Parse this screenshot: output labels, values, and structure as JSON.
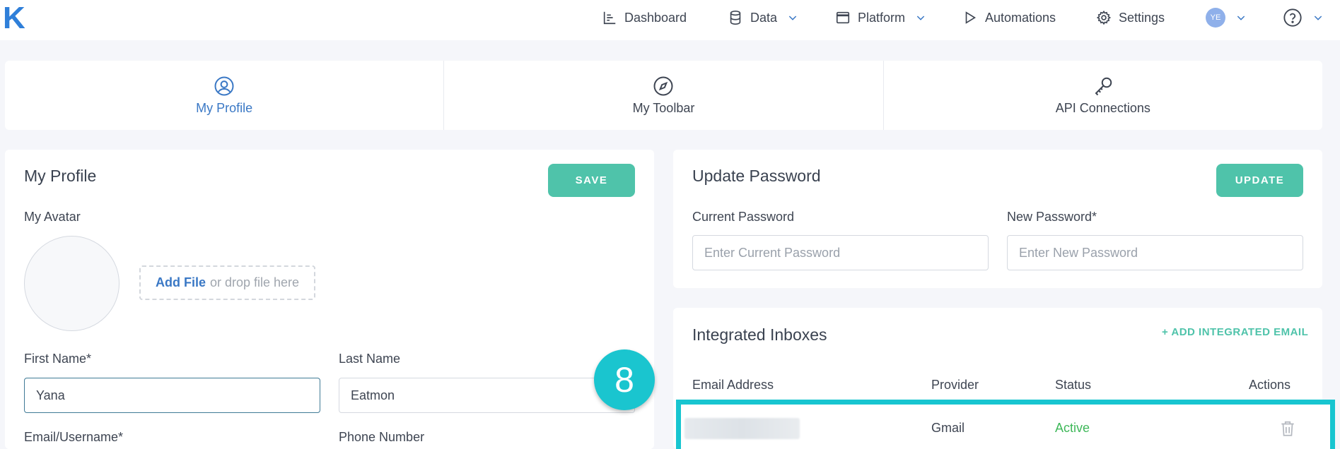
{
  "app": {
    "logo": "K"
  },
  "nav": {
    "dashboard": "Dashboard",
    "data": "Data",
    "platform": "Platform",
    "automations": "Automations",
    "settings": "Settings",
    "user_initials": "YE"
  },
  "tabs": [
    {
      "label": "My Profile",
      "active": true
    },
    {
      "label": "My Toolbar",
      "active": false
    },
    {
      "label": "API Connections",
      "active": false
    }
  ],
  "profile": {
    "title": "My Profile",
    "save_label": "SAVE",
    "avatar_label": "My Avatar",
    "add_file": "Add File",
    "drop_text": "or drop file here",
    "first_name_label": "First Name*",
    "first_name_value": "Yana",
    "last_name_label": "Last Name",
    "last_name_value": "Eatmon",
    "email_label": "Email/Username*",
    "phone_label": "Phone Number"
  },
  "password": {
    "title": "Update Password",
    "update_label": "UPDATE",
    "current_label": "Current Password",
    "current_placeholder": "Enter Current Password",
    "new_label": "New Password*",
    "new_placeholder": "Enter New Password"
  },
  "inboxes": {
    "title": "Integrated Inboxes",
    "add_label": "+ ADD INTEGRATED EMAIL",
    "columns": [
      "Email Address",
      "Provider",
      "Status",
      "Actions"
    ],
    "rows": [
      {
        "provider": "Gmail",
        "status": "Active"
      }
    ]
  },
  "step_badge": "8",
  "colors": {
    "accent": "#4fc3aa",
    "link": "#3a78c5",
    "highlight": "#18c5d0",
    "active_status": "#3fb85a"
  }
}
